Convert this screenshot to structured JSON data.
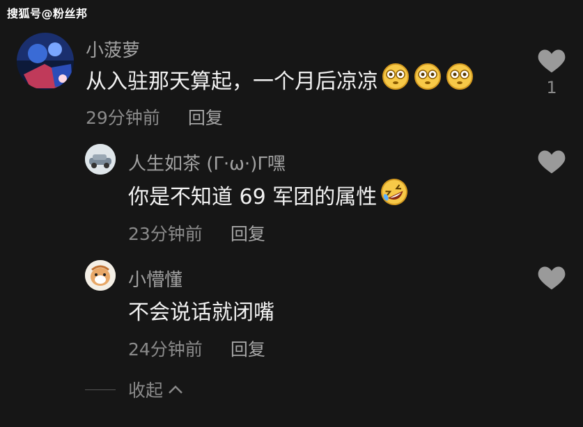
{
  "watermark": "搜狐号@粉丝邦",
  "comments": [
    {
      "username": "小菠萝",
      "text": "从入驻那天算起，一个月后凉凉",
      "time": "29分钟前",
      "reply_label": "回复",
      "like_count": "1",
      "emoji": "flushed-face-icon"
    },
    {
      "username": "人生如茶 (Γ·ω·)Γ嘿",
      "text": "你是不知道 69 军团的属性",
      "time": "23分钟前",
      "reply_label": "回复",
      "like_count": "",
      "emoji": "rolling-laughing-icon"
    },
    {
      "username": "小懵懂",
      "text": "不会说话就闭嘴",
      "time": "24分钟前",
      "reply_label": "回复",
      "like_count": ""
    }
  ],
  "collapse_label": "收起",
  "colors": {
    "background": "#161616",
    "text_primary": "#f2f2f2",
    "text_secondary": "#8b8b8b",
    "heart": "#9a9a9a",
    "emoji_yellow": "#f7c948"
  }
}
